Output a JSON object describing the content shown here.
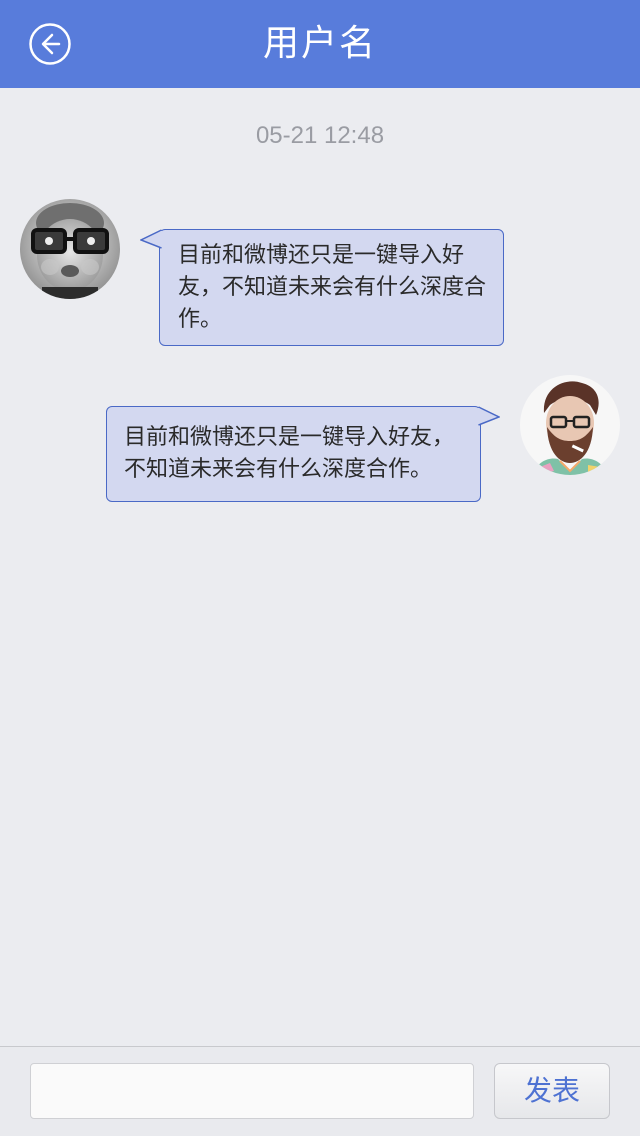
{
  "header": {
    "title": "用户名",
    "back_icon": "back-arrow-circle-icon",
    "color": "#587cdb"
  },
  "chat": {
    "timestamp": "05-21 12:48",
    "messages": [
      {
        "side": "left",
        "avatar": "avatar-boy-glasses",
        "text": "目前和微博还只是一键导入好友，不知道未来会有什么深度合作。"
      },
      {
        "side": "right",
        "avatar": "avatar-bearded-man-glasses",
        "text": "目前和微博还只是一键导入好友，不知道未来会有什么深度合作。"
      }
    ],
    "bubble_color": "#d3d8f0",
    "bubble_border_color": "#4a69c6"
  },
  "footer": {
    "input_value": "",
    "input_placeholder": "",
    "send_label": "发表"
  }
}
